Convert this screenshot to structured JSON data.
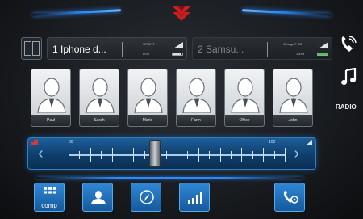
{
  "phones": [
    {
      "name": "1 Iphone d...",
      "operator": "SPRINT",
      "battery_text": "80%",
      "signal_bars": 4,
      "battery_level": 0.8,
      "active": true
    },
    {
      "name": "2 Samsu...",
      "operator": "Orange F 4G",
      "battery_text": "100%",
      "signal_bars": 4,
      "battery_level": 1.0,
      "active": false
    }
  ],
  "contacts": [
    {
      "label": "Paul"
    },
    {
      "label": "Sarah"
    },
    {
      "label": "Mario"
    },
    {
      "label": "Farm"
    },
    {
      "label": "Office"
    },
    {
      "label": "John"
    }
  ],
  "slider": {
    "min_label": "00",
    "max_label": "100",
    "value": 40,
    "accent": "#1d5f9a"
  },
  "bottom_buttons": [
    {
      "id": "comp",
      "label": "comp",
      "icon": "keypad-icon"
    },
    {
      "id": "contacts",
      "label": "",
      "icon": "contact-icon"
    },
    {
      "id": "navigation",
      "label": "",
      "icon": "compass-icon"
    },
    {
      "id": "signal",
      "label": "",
      "icon": "signal-icon"
    },
    {
      "id": "call-settings",
      "label": "",
      "icon": "phone-gear-icon"
    }
  ],
  "sidebar": {
    "phone_icon": "phone-icon",
    "music_icon": "music-note-icon",
    "radio_label": "RADIO"
  },
  "colors": {
    "accent_blue": "#2c8cff",
    "brand_red": "#c81e1e",
    "battery_green": "#3fcf4a"
  }
}
